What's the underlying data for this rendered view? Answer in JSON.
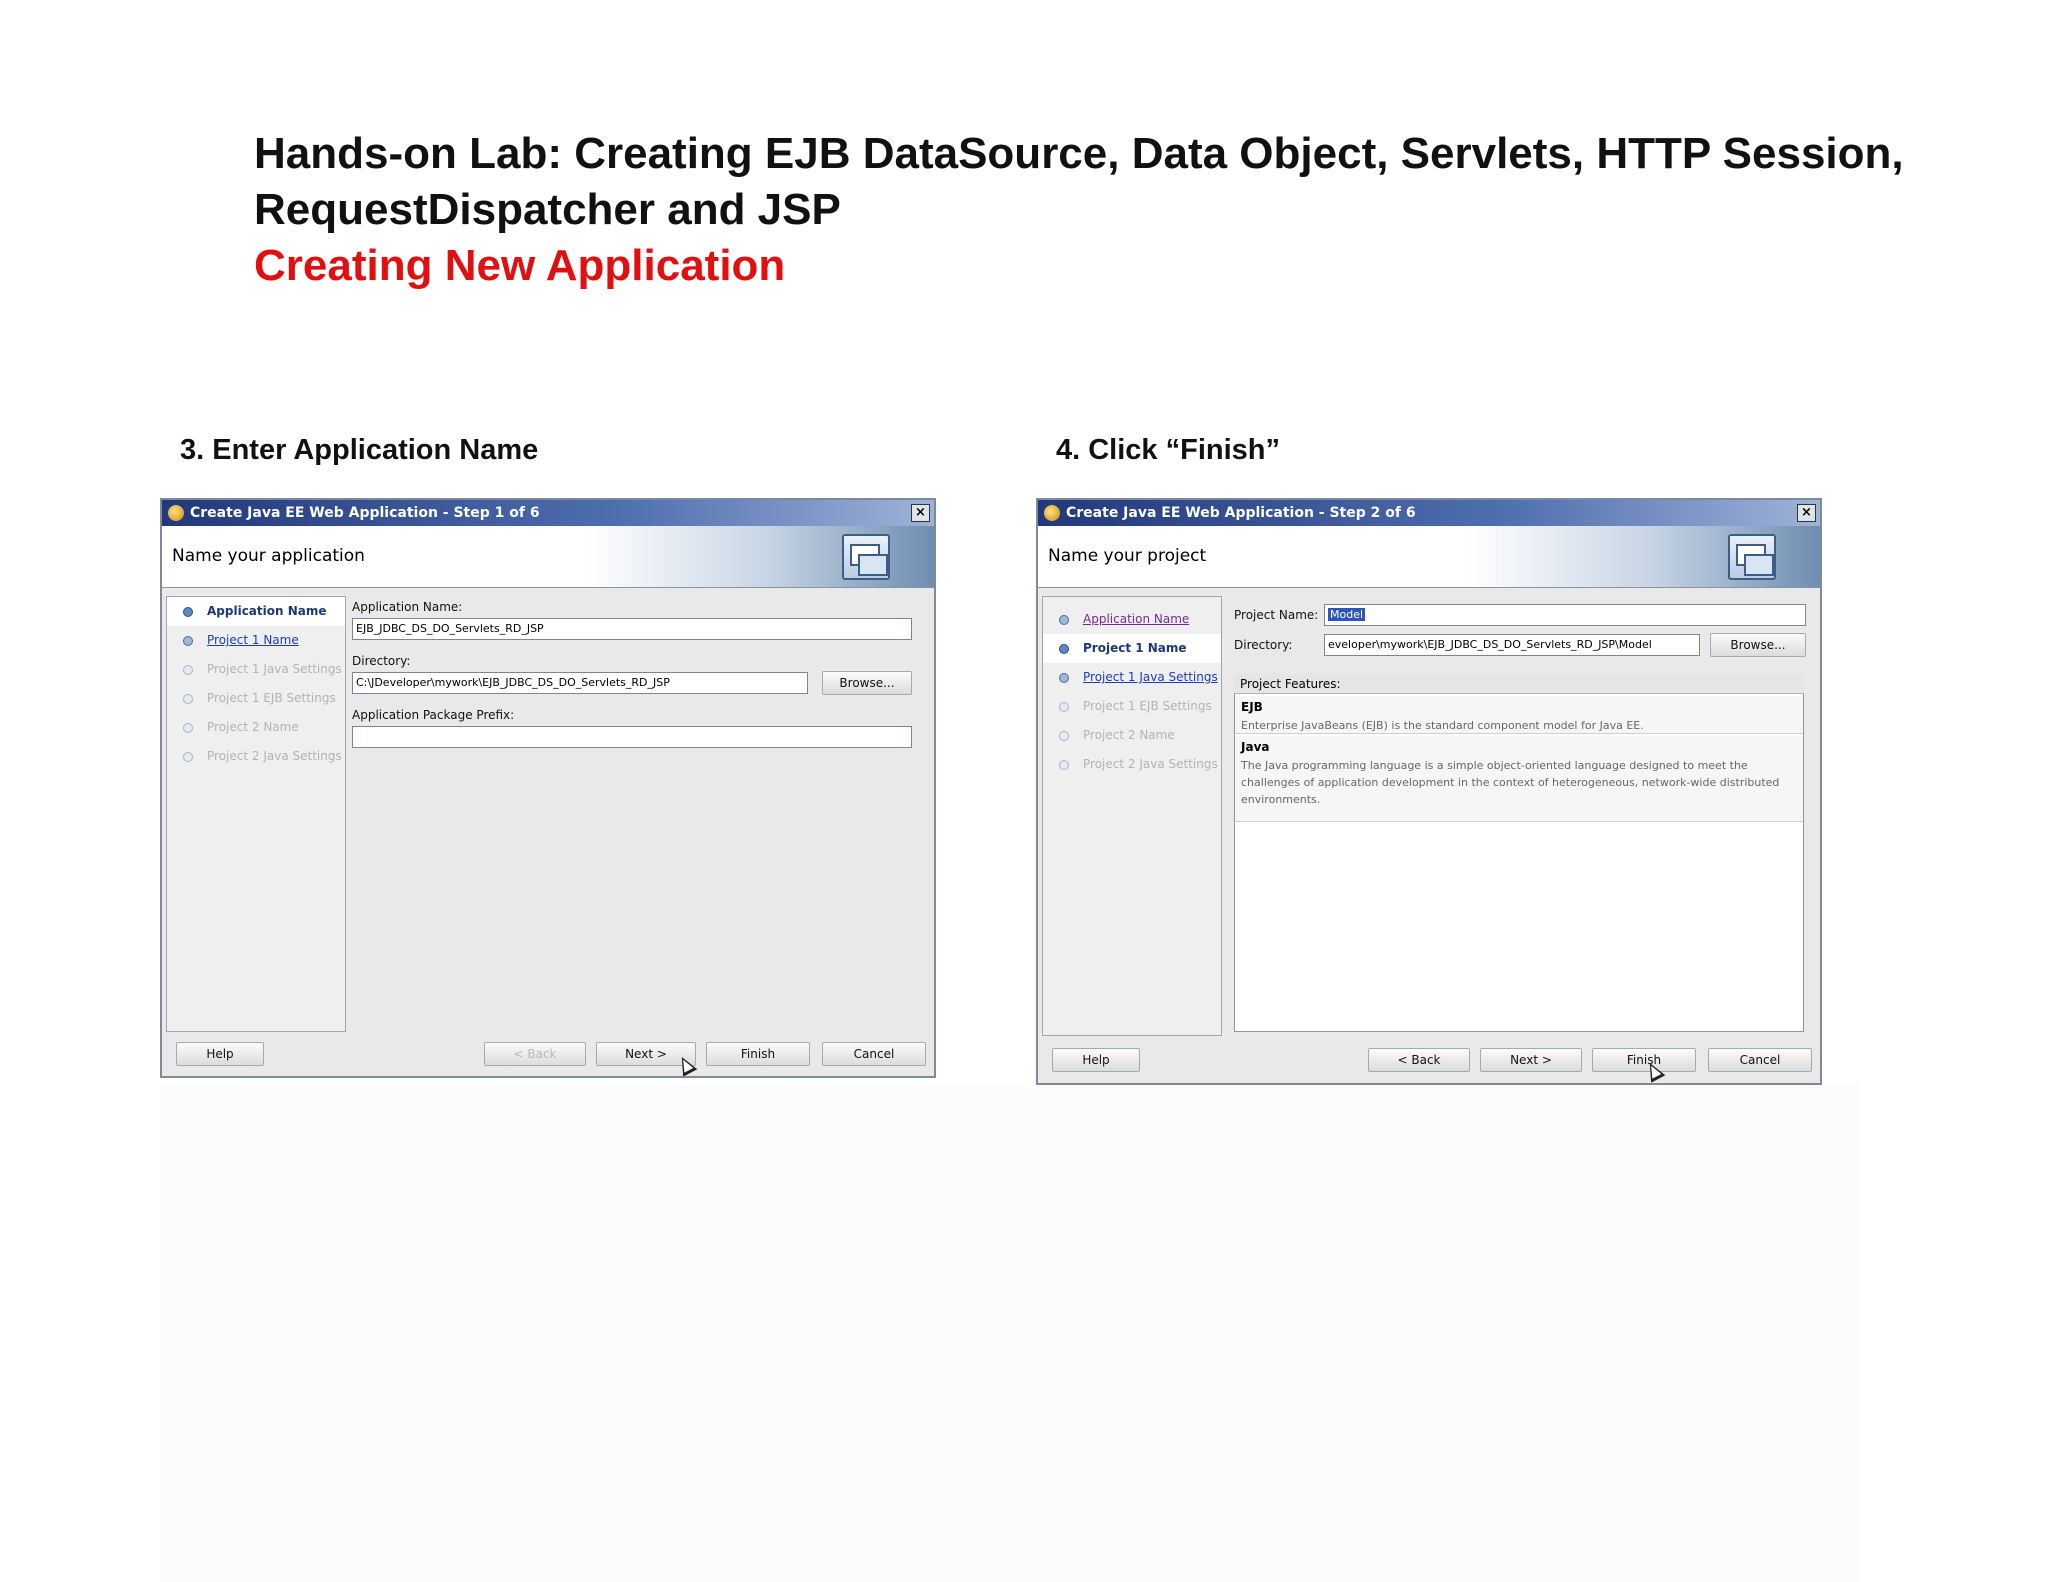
{
  "page": {
    "title": "Hands-on Lab: Creating EJB DataSource, Data Object, Servlets, HTTP Session, RequestDispatcher and JSP",
    "subtitle": "Creating New Application",
    "step3_caption": "3. Enter Application Name",
    "step4_caption": "4. Click “Finish”",
    "subtitle_color": "#e01010"
  },
  "dialog1": {
    "window_title": "Create Java EE Web Application - Step 1 of 6",
    "header_title": "Name your application",
    "close_icon": "close-icon",
    "nav_items": [
      {
        "label": "Application Name",
        "state": "current"
      },
      {
        "label": "Project 1 Name",
        "state": "link"
      },
      {
        "label": "Project 1 Java Settings",
        "state": "disabled"
      },
      {
        "label": "Project 1 EJB Settings",
        "state": "disabled"
      },
      {
        "label": "Project 2 Name",
        "state": "disabled"
      },
      {
        "label": "Project 2 Java Settings",
        "state": "disabled"
      }
    ],
    "app_name_label": "Application Name:",
    "app_name_value": "EJB_JDBC_DS_DO_Servlets_RD_JSP",
    "directory_label": "Directory:",
    "directory_value": "C:\\JDeveloper\\mywork\\EJB_JDBC_DS_DO_Servlets_RD_JSP",
    "browse_label": "Browse...",
    "package_label": "Application Package Prefix:",
    "package_value": "",
    "buttons": {
      "help": "Help",
      "back": "< Back",
      "next": "Next >",
      "finish": "Finish",
      "cancel": "Cancel"
    }
  },
  "dialog2": {
    "window_title": "Create Java EE Web Application - Step 2 of 6",
    "header_title": "Name your project",
    "nav_items": [
      {
        "label": "Application Name",
        "state": "visited"
      },
      {
        "label": "Project 1 Name",
        "state": "current"
      },
      {
        "label": "Project 1 Java Settings",
        "state": "link"
      },
      {
        "label": "Project 1 EJB Settings",
        "state": "disabled"
      },
      {
        "label": "Project 2 Name",
        "state": "disabled"
      },
      {
        "label": "Project 2 Java Settings",
        "state": "disabled"
      }
    ],
    "project_name_label": "Project Name:",
    "project_name_value": "Model",
    "directory_label": "Directory:",
    "directory_value": "eveloper\\mywork\\EJB_JDBC_DS_DO_Servlets_RD_JSP\\Model",
    "browse_label": "Browse...",
    "features_header": "Project Features:",
    "features": [
      {
        "title": "EJB",
        "desc": "Enterprise JavaBeans (EJB) is the standard component model for Java EE."
      },
      {
        "title": "Java",
        "desc": "The Java programming language is a simple object-oriented language designed to meet the challenges of application development in the context of heterogeneous, network-wide distributed environments."
      }
    ],
    "buttons": {
      "help": "Help",
      "back": "< Back",
      "next": "Next >",
      "finish": "Finish",
      "cancel": "Cancel"
    }
  }
}
